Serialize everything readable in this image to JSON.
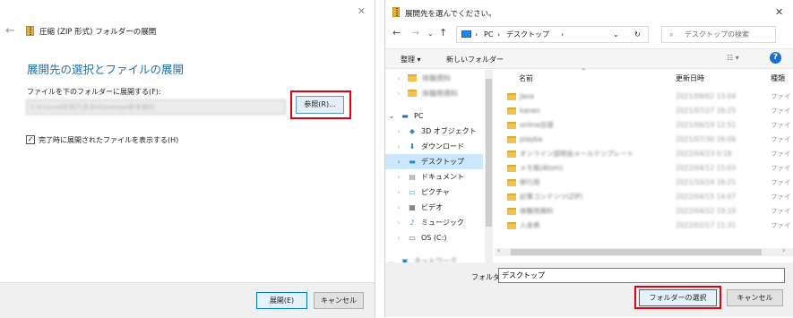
{
  "extract_wizard": {
    "title": "圧縮 (ZIP 形式) フォルダーの展開",
    "heading": "展開先の選択とファイルの展開",
    "folder_label": "ファイルを下のフォルダーに展開する(F):",
    "path_value": "C:¥Users¥名刺乃多多¥Desktop¥参考資料",
    "browse_button": "参照(R)...",
    "show_files_checkbox": {
      "label": "完了時に展開されたファイルを表示する(H)",
      "checked": true
    },
    "extract_button": "展開(E)",
    "cancel_button": "キャンセル"
  },
  "folder_picker": {
    "title": "展開先を選んでください。",
    "breadcrumb": [
      "PC",
      "デスクトップ"
    ],
    "search_placeholder": "デスクトップの検索",
    "toolbar": {
      "organize": "整理 ▾",
      "new_folder": "新しいフォルダー"
    },
    "tree": [
      {
        "label": "体験資料",
        "blurred": true
      },
      {
        "label": "体験用資料",
        "blurred": true
      },
      {
        "label": "PC",
        "icon": "pc-icon",
        "expanded": true
      },
      {
        "label": "3D オブジェクト",
        "icon": "3d-objects-icon"
      },
      {
        "label": "ダウンロード",
        "icon": "download-icon"
      },
      {
        "label": "デスクトップ",
        "icon": "desktop-icon",
        "selected": true
      },
      {
        "label": "ドキュメント",
        "icon": "document-icon"
      },
      {
        "label": "ピクチャ",
        "icon": "picture-icon"
      },
      {
        "label": "ビデオ",
        "icon": "video-icon"
      },
      {
        "label": "ミュージック",
        "icon": "music-icon"
      },
      {
        "label": "OS (C:)",
        "icon": "drive-icon"
      },
      {
        "label": "ネットワーク",
        "blurred": true
      }
    ],
    "columns": {
      "name": "名前",
      "modified": "更新日時",
      "type": "種類"
    },
    "files": [
      {
        "name": "Java",
        "modified": "2021/09/02 13:04",
        "type": "ファイ"
      },
      {
        "name": "kanen",
        "modified": "2021/07/27 16:25",
        "type": "ファイ"
      },
      {
        "name": "online自習",
        "modified": "2021/06/19 12:51",
        "type": "ファイ"
      },
      {
        "name": "playba",
        "modified": "2021/07/30 16:06",
        "type": "ファイ"
      },
      {
        "name": "オンライン説明会メールテンプレート",
        "modified": "2022/04/23 0:18",
        "type": "ファイ"
      },
      {
        "name": "メモ帳(Atom)",
        "modified": "2022/04/12 15:03",
        "type": "ファイ"
      },
      {
        "name": "移行用",
        "modified": "2021/10/24 16:21",
        "type": "ファイ"
      },
      {
        "name": "記事コンテンツ(ZIP)",
        "modified": "2022/04/15 14:07",
        "type": "ファイ"
      },
      {
        "name": "体験用資料",
        "modified": "2022/04/22 19:10",
        "type": "ファイ"
      },
      {
        "name": "入金表",
        "modified": "2022/02/17 11:31",
        "type": "ファイ"
      }
    ],
    "folder_label": "フォルダー:",
    "folder_value": "デスクトップ",
    "select_button": "フォルダーの選択",
    "cancel_button": "キャンセル"
  },
  "colors": {
    "accent": "#0078d7",
    "heading": "#1a6fb0",
    "highlight_box": "#e0000f"
  }
}
